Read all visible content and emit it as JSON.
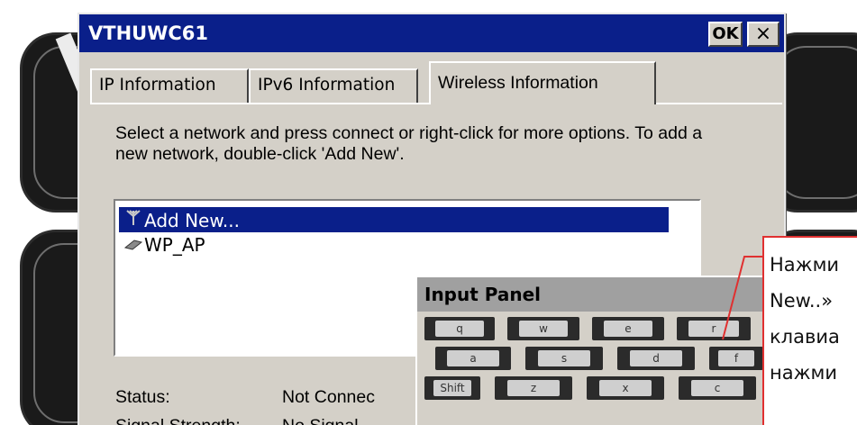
{
  "dialog": {
    "title": "VTHUWC61",
    "ok_label": "OK",
    "close_label": "×"
  },
  "tabs": [
    {
      "label": "IP Information",
      "active": false
    },
    {
      "label": "IPv6 Information",
      "active": false
    },
    {
      "label": "Wireless Information",
      "active": true
    }
  ],
  "instructions": "Select a network and press connect or right-click for more options.  To add a new network, double-click 'Add New'.",
  "networks": [
    {
      "label": "Add New...",
      "icon": "antenna-icon",
      "selected": true
    },
    {
      "label": "WP_AP",
      "icon": "network-icon",
      "selected": false
    }
  ],
  "status": {
    "status_label": "Status:",
    "status_value": "Not Connec",
    "signal_label": "Signal Strength:",
    "signal_value": "No Signal"
  },
  "input_panel": {
    "title": "Input Panel",
    "rows": [
      [
        "q",
        "w",
        "e",
        "r"
      ],
      [
        "a",
        "s",
        "d",
        "f"
      ],
      [
        "Shift",
        "z",
        "x",
        "c"
      ]
    ]
  },
  "annotation": {
    "lines": [
      "Нажми",
      "New..»",
      "клавиа",
      "нажми"
    ],
    "border_color": "#e03030"
  },
  "colors": {
    "titlebar": "#0a1f8a",
    "selection": "#0a1f8a",
    "dialog_bg": "#d4d0c8"
  }
}
